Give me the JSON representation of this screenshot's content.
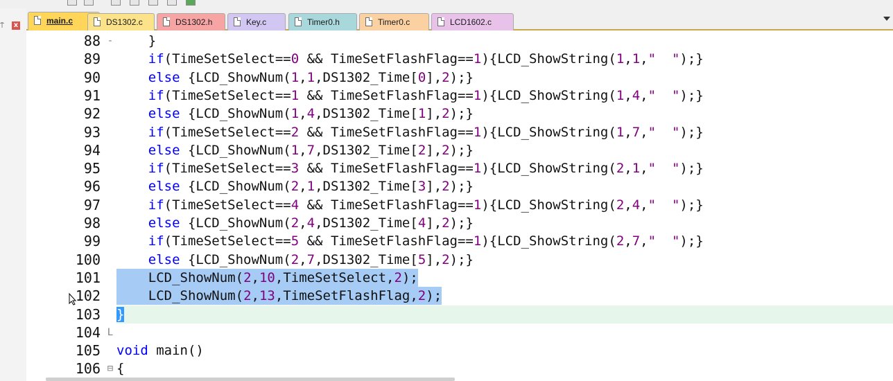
{
  "toolbar": {
    "icons": [
      "window-icon",
      "build-icon",
      "layout-icon",
      "grid-icon",
      "diamond-icon",
      "download-icon",
      "debug-icon"
    ]
  },
  "left_pane": {
    "pin_glyph": "⍑",
    "close_glyph": "x"
  },
  "tabs": [
    {
      "label": "main.c",
      "color": "#ffd659",
      "active": true
    },
    {
      "label": "DS1302.c",
      "color": "#fce38a"
    },
    {
      "label": "DS1302.h",
      "color": "#f7a4a4"
    },
    {
      "label": "Key.c",
      "color": "#d2c7f2"
    },
    {
      "label": "Timer0.h",
      "color": "#a9d8dc"
    },
    {
      "label": "Timer0.c",
      "color": "#fbd1a2"
    },
    {
      "label": "LCD1602.c",
      "color": "#e8c2e8"
    }
  ],
  "editor": {
    "line_numbers": [
      "88",
      "89",
      "90",
      "91",
      "92",
      "93",
      "94",
      "95",
      "96",
      "97",
      "98",
      "99",
      "100",
      "101",
      "102",
      "103",
      "104",
      "105",
      "106"
    ],
    "fold_markers": [
      "-",
      "",
      "",
      "",
      "",
      "",
      "",
      "",
      "",
      "",
      "",
      "",
      "",
      "",
      "",
      "",
      "L",
      "",
      "⊟"
    ],
    "lines": [
      {
        "text": "    }"
      },
      {
        "text": "    if(TimeSetSelect==0 && TimeSetFlashFlag==1){LCD_ShowString(1,1,\"  \");}"
      },
      {
        "text": "    else {LCD_ShowNum(1,1,DS1302_Time[0],2);}"
      },
      {
        "text": "    if(TimeSetSelect==1 && TimeSetFlashFlag==1){LCD_ShowString(1,4,\"  \");}"
      },
      {
        "text": "    else {LCD_ShowNum(1,4,DS1302_Time[1],2);}"
      },
      {
        "text": "    if(TimeSetSelect==2 && TimeSetFlashFlag==1){LCD_ShowString(1,7,\"  \");}"
      },
      {
        "text": "    else {LCD_ShowNum(1,7,DS1302_Time[2],2);}"
      },
      {
        "text": "    if(TimeSetSelect==3 && TimeSetFlashFlag==1){LCD_ShowString(2,1,\"  \");}"
      },
      {
        "text": "    else {LCD_ShowNum(2,1,DS1302_Time[3],2);}"
      },
      {
        "text": "    if(TimeSetSelect==4 && TimeSetFlashFlag==1){LCD_ShowString(2,4,\"  \");}"
      },
      {
        "text": "    else {LCD_ShowNum(2,4,DS1302_Time[4],2);}"
      },
      {
        "text": "    if(TimeSetSelect==5 && TimeSetFlashFlag==1){LCD_ShowString(2,7,\"  \");}"
      },
      {
        "text": "    else {LCD_ShowNum(2,7,DS1302_Time[5],2);}"
      },
      {
        "text": "    LCD_ShowNum(2,10,TimeSetSelect,2);",
        "selected": true
      },
      {
        "text": "    LCD_ShowNum(2,13,TimeSetFlashFlag,2);",
        "selected": true
      },
      {
        "text": "}",
        "current": true,
        "brace": true
      },
      {
        "text": ""
      },
      {
        "text": "void main()"
      },
      {
        "text": "{"
      }
    ]
  },
  "colors": {
    "keyword": "#0000ff",
    "literal": "#800080",
    "selection": "#a6cbf4",
    "current_line": "#e7f6ea"
  }
}
